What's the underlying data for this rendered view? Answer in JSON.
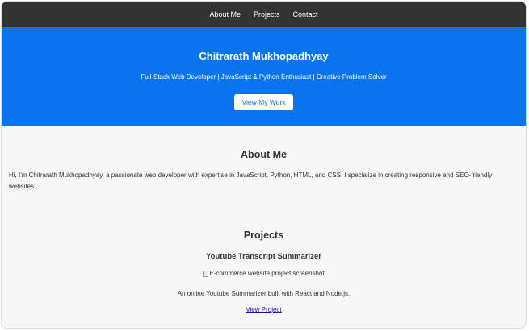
{
  "nav": {
    "items": [
      {
        "label": "About Me"
      },
      {
        "label": "Projects"
      },
      {
        "label": "Contact"
      }
    ]
  },
  "hero": {
    "title": "Chitrarath Mukhopadhyay",
    "subtitle": "Full-Stack Web Developer | JavaScript & Python Enthusiast | Creative Problem Solver",
    "button_label": "View My Work"
  },
  "about": {
    "title": "About Me",
    "text": "Hi, I'm Chitrarath Mukhopadhyay, a passionate web developer with expertise in JavaScript, Python, HTML, and CSS. I specialize in creating responsive and SEO-friendly websites."
  },
  "projects": {
    "title": "Projects",
    "items": [
      {
        "title": "Youtube Transcript Summarizer",
        "image_alt": "E-commerce website project screenshot",
        "description": "An online Youtube Summarizer built with React and Node.js.",
        "link_label": "View Project"
      }
    ]
  },
  "colors": {
    "navbar": "#333333",
    "hero": "#0a74ee",
    "page_bg": "#f7f7f7",
    "link": "#1a0dab"
  }
}
